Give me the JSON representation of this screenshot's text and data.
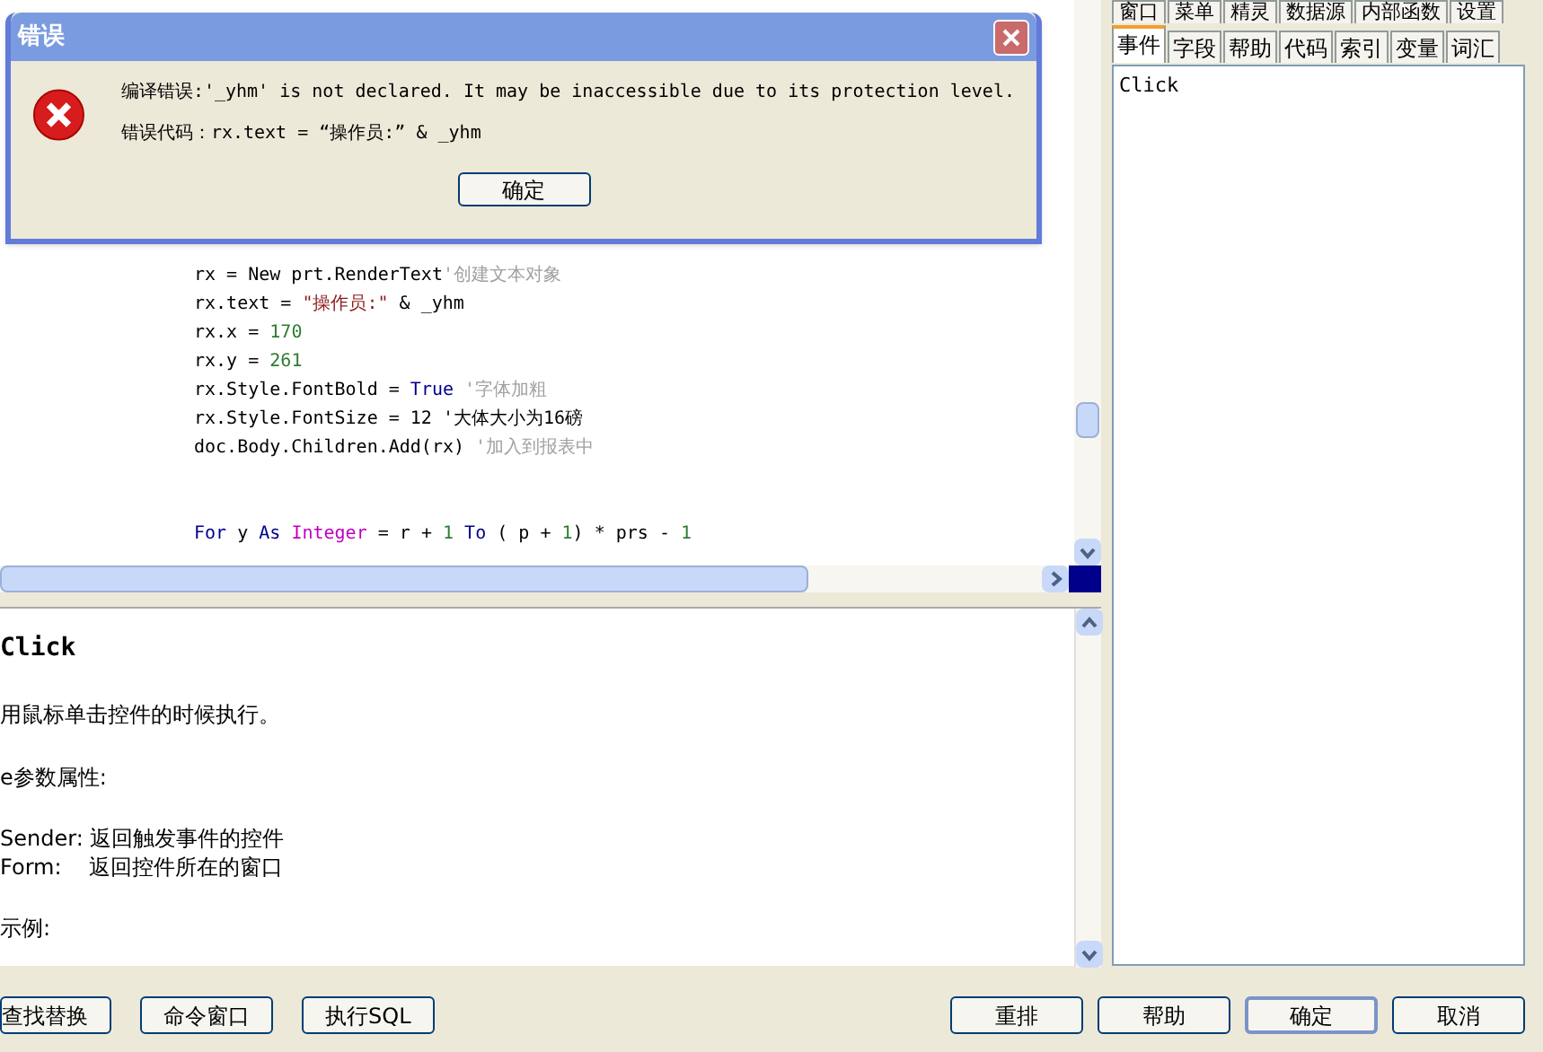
{
  "editor": {
    "blocks": [
      [
        [
          {
            "kind": "plain",
            "text": "rx = New prt.RenderText"
          },
          {
            "kind": "comment",
            "text": "'创建文本对象"
          }
        ],
        [
          {
            "kind": "plain",
            "text": "rx.text = "
          },
          {
            "kind": "string",
            "text": "\"操作员:\""
          },
          {
            "kind": "plain",
            "text": " & _yhm"
          }
        ],
        [
          {
            "kind": "plain",
            "text": "rx.x = "
          },
          {
            "kind": "number",
            "text": "170"
          }
        ],
        [
          {
            "kind": "plain",
            "text": "rx.y = "
          },
          {
            "kind": "number",
            "text": "261"
          }
        ],
        [
          {
            "kind": "plain",
            "text": "rx.Style.FontBold = "
          },
          {
            "kind": "keyword",
            "text": "True"
          },
          {
            "kind": "comment",
            "text": " '字体加粗"
          }
        ],
        [
          {
            "kind": "plain",
            "text": "rx.Style.FontSize = 12 '大体大小为16磅"
          }
        ],
        [
          {
            "kind": "plain",
            "text": "doc.Body.Children.Add(rx)"
          },
          {
            "kind": "comment",
            "text": " '加入到报表中"
          }
        ]
      ],
      [
        [
          {
            "kind": "keyword",
            "text": "For"
          },
          {
            "kind": "plain",
            "text": " y "
          },
          {
            "kind": "keyword",
            "text": "As"
          },
          {
            "kind": "type",
            "text": " Integer"
          },
          {
            "kind": "plain",
            "text": " = r + "
          },
          {
            "kind": "number",
            "text": "1"
          },
          {
            "kind": "keyword",
            "text": " To"
          },
          {
            "kind": "plain",
            "text": " ( p + "
          },
          {
            "kind": "number",
            "text": "1"
          },
          {
            "kind": "plain",
            "text": ") * prs - "
          },
          {
            "kind": "number",
            "text": "1"
          }
        ]
      ]
    ]
  },
  "help": {
    "title": "Click",
    "paragraphs": [
      "用鼠标单击控件的时候执行。",
      "e参数属性:",
      [
        "Sender: 返回触发事件的控件",
        "Form:    返回控件所在的窗口"
      ],
      "示例:"
    ]
  },
  "side_tabs": {
    "row_1": [
      {
        "label": "窗口",
        "selected": false
      },
      {
        "label": "菜单",
        "selected": false
      },
      {
        "label": "精灵",
        "selected": false
      },
      {
        "label": "数据源",
        "selected": false
      },
      {
        "label": "内部函数",
        "selected": false
      },
      {
        "label": "设置",
        "selected": false
      }
    ],
    "row_2": [
      {
        "label": "事件",
        "selected": true
      },
      {
        "label": "字段",
        "selected": false
      },
      {
        "label": "帮助",
        "selected": false
      },
      {
        "label": "代码",
        "selected": false
      },
      {
        "label": "索引",
        "selected": false
      },
      {
        "label": "变量",
        "selected": false
      },
      {
        "label": "词汇",
        "selected": false
      }
    ]
  },
  "event_list": [
    {
      "label": "Click",
      "selected": false
    }
  ],
  "left_buttons": [
    "查找替换",
    "命令窗口",
    "执行SQL"
  ],
  "right_buttons": [
    {
      "label": "重排",
      "default": false
    },
    {
      "label": "帮助",
      "default": false
    },
    {
      "label": "确定",
      "default": true
    },
    {
      "label": "取消",
      "default": false
    }
  ],
  "dialog": {
    "title": "错误",
    "message": "编译错误:'_yhm' is not declared. It may be inaccessible due to its protection level.",
    "code": "错误代码：rx.text = “操作员:” & _yhm",
    "button": "确定"
  }
}
